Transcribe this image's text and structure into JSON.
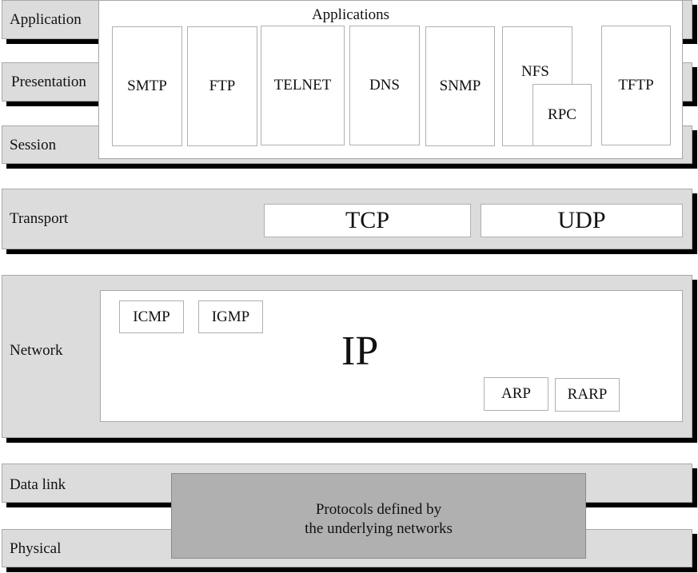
{
  "layers": {
    "application": "Application",
    "presentation": "Presentation",
    "session": "Session",
    "transport": "Transport",
    "network": "Network",
    "data_link": "Data link",
    "physical": "Physical"
  },
  "applications": {
    "title": "Applications",
    "items": [
      "SMTP",
      "FTP",
      "TELNET",
      "DNS",
      "SNMP",
      "NFS",
      "RPC",
      "TFTP"
    ]
  },
  "transport": {
    "tcp": "TCP",
    "udp": "UDP"
  },
  "network": {
    "ip": "IP",
    "icmp": "ICMP",
    "igmp": "IGMP",
    "arp": "ARP",
    "rarp": "RARP"
  },
  "lower": {
    "line1": "Protocols defined by",
    "line2": "the underlying networks"
  },
  "colors": {
    "layer_fill": "#dcdcdc",
    "shadow": "#000000",
    "lower_box": "#b0b0b0"
  }
}
